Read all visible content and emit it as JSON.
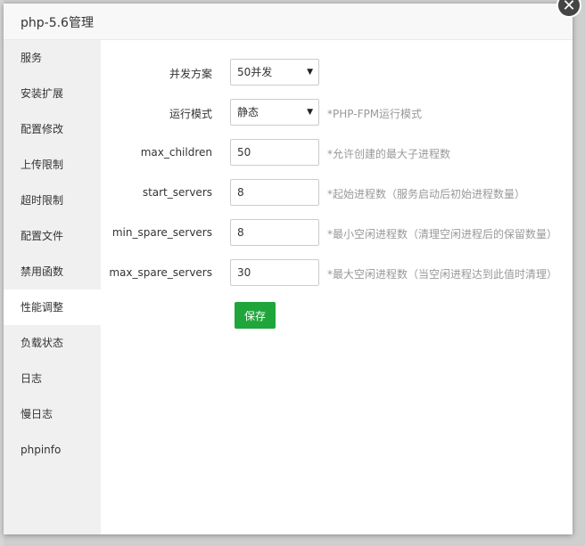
{
  "dialog": {
    "title": "php-5.6管理",
    "close_glyph": "✕"
  },
  "sidebar": {
    "items": [
      {
        "label": "服务"
      },
      {
        "label": "安装扩展"
      },
      {
        "label": "配置修改"
      },
      {
        "label": "上传限制"
      },
      {
        "label": "超时限制"
      },
      {
        "label": "配置文件"
      },
      {
        "label": "禁用函数"
      },
      {
        "label": "性能调整"
      },
      {
        "label": "负载状态"
      },
      {
        "label": "日志"
      },
      {
        "label": "慢日志"
      },
      {
        "label": "phpinfo"
      }
    ],
    "active": "性能调整"
  },
  "form": {
    "concurrency": {
      "label": "并发方案",
      "value": "50并发"
    },
    "run_mode": {
      "label": "运行模式",
      "value": "静态",
      "hint": "*PHP-FPM运行模式"
    },
    "max_children": {
      "label": "max_children",
      "value": "50",
      "hint": "*允许创建的最大子进程数"
    },
    "start_servers": {
      "label": "start_servers",
      "value": "8",
      "hint": "*起始进程数（服务启动后初始进程数量）"
    },
    "min_spare_servers": {
      "label": "min_spare_servers",
      "value": "8",
      "hint": "*最小空闲进程数（清理空闲进程后的保留数量）"
    },
    "max_spare_servers": {
      "label": "max_spare_servers",
      "value": "30",
      "hint": "*最大空闲进程数（当空闲进程达到此值时清理）"
    },
    "select_arrow": "▼",
    "save_label": "保存"
  }
}
